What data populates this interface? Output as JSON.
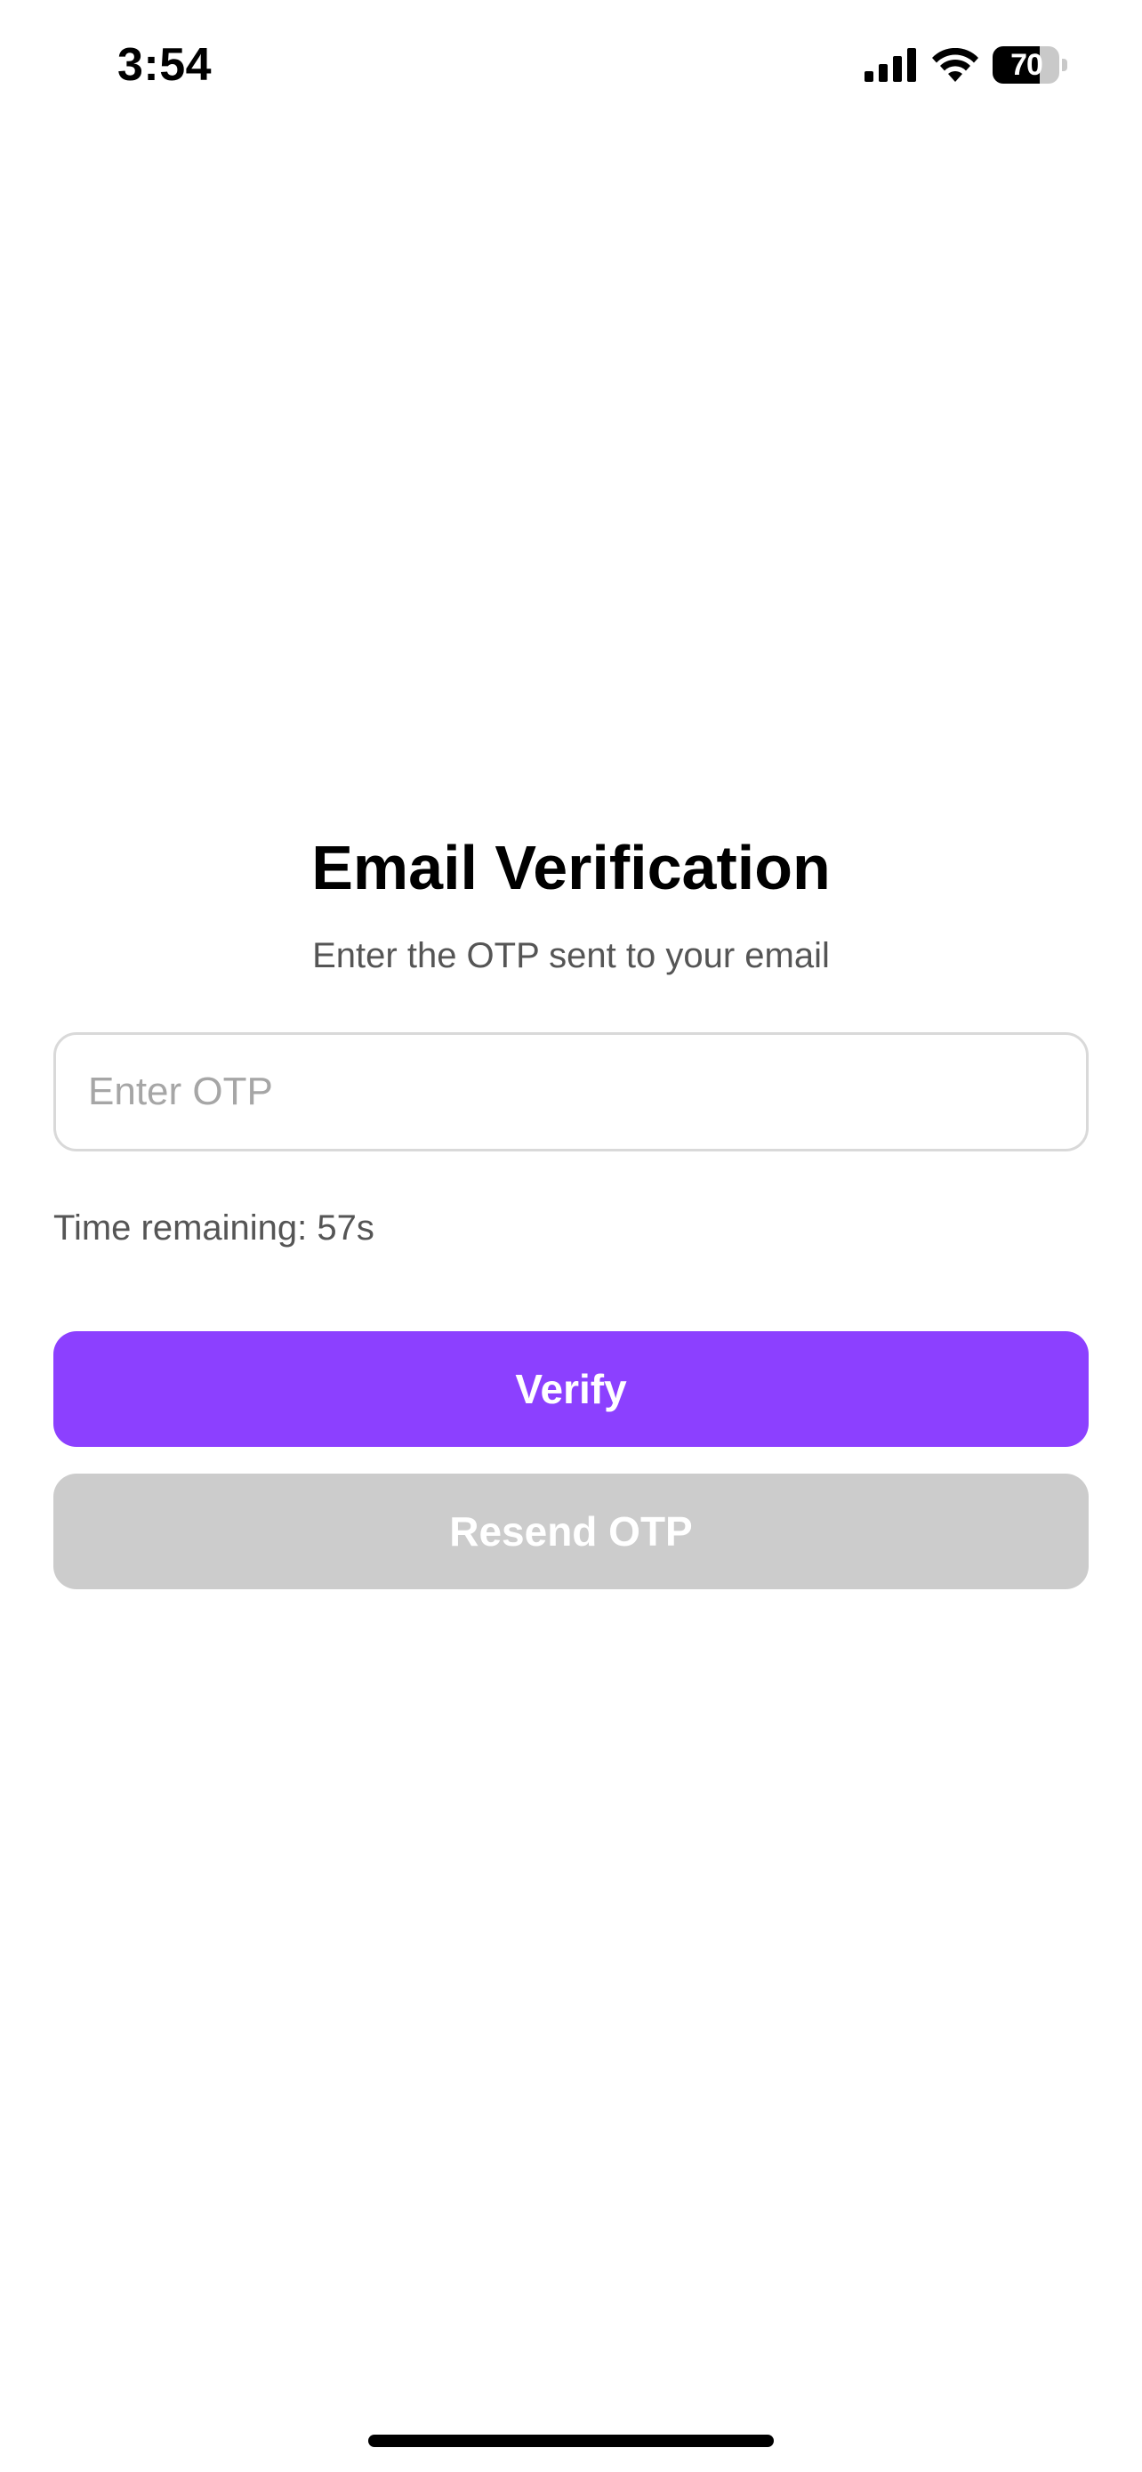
{
  "status_bar": {
    "time": "3:54",
    "battery_level": "70",
    "icons": [
      "cellular-signal-icon",
      "wifi-icon",
      "battery-icon"
    ]
  },
  "screen": {
    "title": "Email Verification",
    "subtitle": "Enter the OTP sent to your email",
    "otp_input": {
      "placeholder": "Enter OTP",
      "value": ""
    },
    "timer_text": "Time remaining: 57s",
    "verify_button_label": "Verify",
    "resend_button_label": "Resend OTP"
  },
  "colors": {
    "accent": "#8C40FF",
    "disabled_button": "#CCCCCC",
    "secondary_text": "#555555",
    "input_border": "#D9D9D9"
  }
}
